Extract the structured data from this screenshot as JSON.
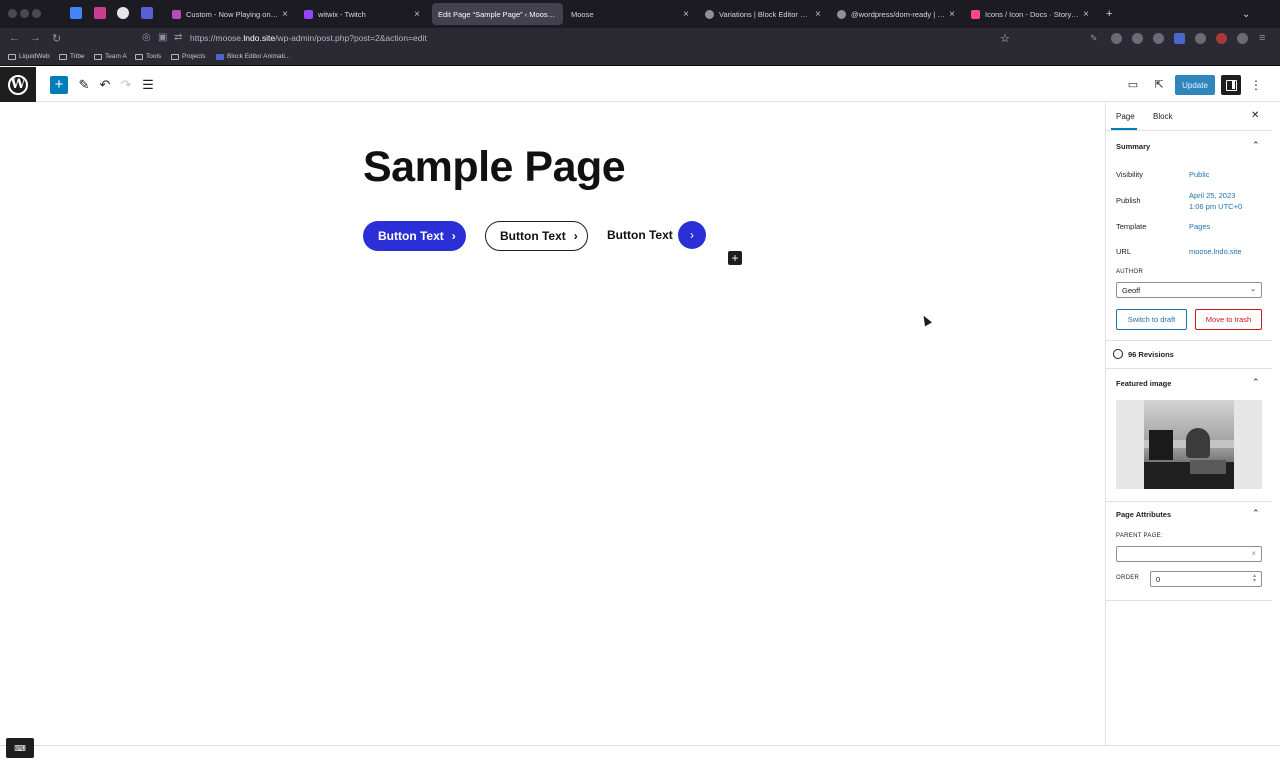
{
  "browser": {
    "tabs": [
      {
        "title": "Custom - Now Playing on Pand…",
        "color": "#b64bbd"
      },
      {
        "title": "witwix - Twitch",
        "color": "#9146ff"
      },
      {
        "title": "Edit Page “Sample Page” ‹ Moose —",
        "color": "#5a5a66"
      },
      {
        "title": "Moose",
        "color": "#5a5a66"
      },
      {
        "title": "Variations | Block Editor Handb…",
        "color": "#8f8f9d"
      },
      {
        "title": "@wordpress/dom-ready | Block…",
        "color": "#8f8f9d"
      },
      {
        "title": "Icons / Icon - Docs · Storybook",
        "color": "#ff4785"
      }
    ],
    "url_prefix": "https://moose.",
    "url_host": "lndo.site",
    "url_path": "/wp-admin/post.php?post=2&action=edit",
    "bookmarks": [
      "LiquidWeb",
      "Tribe",
      "Team A",
      "Tools",
      "Projects",
      "Block Editor Animati..."
    ]
  },
  "editor": {
    "update_label": "Update"
  },
  "canvas": {
    "title": "Sample Page",
    "button_1": "Button Text",
    "button_2": "Button Text",
    "button_3": "Button Text"
  },
  "sidebar": {
    "tab_page": "Page",
    "tab_block": "Block",
    "summary_heading": "Summary",
    "visibility_label": "Visibility",
    "visibility_value": "Public",
    "publish_label": "Publish",
    "publish_date": "April 25, 2023",
    "publish_time": "1:06 pm UTC+0",
    "template_label": "Template",
    "template_value": "Pages",
    "url_label": "URL",
    "url_value": "moose.lndo.site",
    "author_label": "AUTHOR",
    "author_value": "Geoff",
    "switch_draft": "Switch to draft",
    "move_trash": "Move to trash",
    "revisions": "96 Revisions",
    "featured_heading": "Featured image",
    "attributes_heading": "Page Attributes",
    "parent_label": "PARENT PAGE:",
    "parent_value": "",
    "order_label": "ORDER",
    "order_value": "0"
  }
}
